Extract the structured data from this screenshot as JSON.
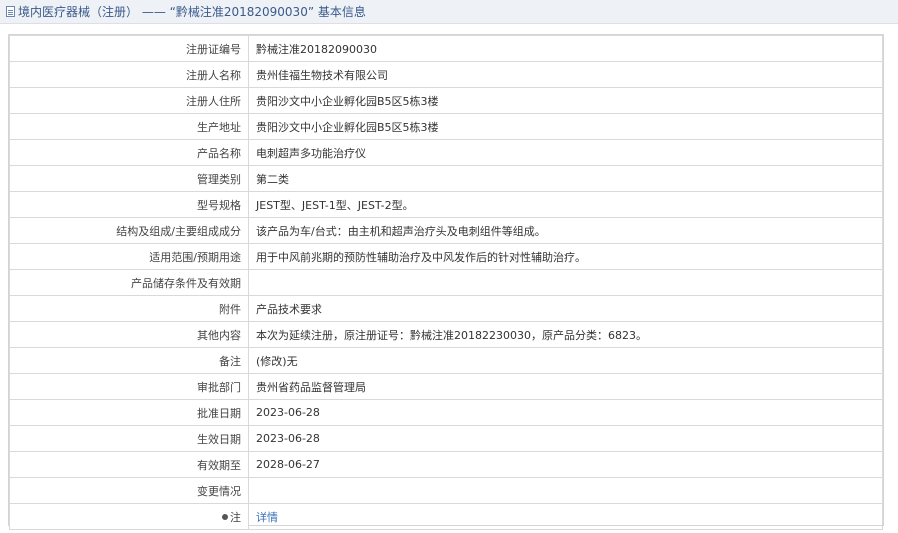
{
  "header": {
    "title": "境内医疗器械（注册） —— “黔械注准20182090030” 基本信息",
    "icon": "document-icon"
  },
  "rows": [
    {
      "label": "注册证编号",
      "value": "黔械注准20182090030"
    },
    {
      "label": "注册人名称",
      "value": "贵州佳福生物技术有限公司"
    },
    {
      "label": "注册人住所",
      "value": "贵阳沙文中小企业孵化园B5区5栋3楼"
    },
    {
      "label": "生产地址",
      "value": "贵阳沙文中小企业孵化园B5区5栋3楼"
    },
    {
      "label": "产品名称",
      "value": "电刺超声多功能治疗仪"
    },
    {
      "label": "管理类别",
      "value": "第二类"
    },
    {
      "label": "型号规格",
      "value": "JEST型、JEST-1型、JEST-2型。"
    },
    {
      "label": "结构及组成/主要组成成分",
      "value": "该产品为车/台式：由主机和超声治疗头及电刺组件等组成。"
    },
    {
      "label": "适用范围/预期用途",
      "value": "用于中风前兆期的预防性辅助治疗及中风发作后的针对性辅助治疗。"
    },
    {
      "label": "产品储存条件及有效期",
      "value": ""
    },
    {
      "label": "附件",
      "value": "产品技术要求"
    },
    {
      "label": "其他内容",
      "value": "本次为延续注册，原注册证号：黔械注准20182230030，原产品分类：6823。"
    },
    {
      "label": "备注",
      "value": "(修改)无"
    },
    {
      "label": "审批部门",
      "value": "贵州省药品监督管理局"
    },
    {
      "label": "批准日期",
      "value": "2023-06-28"
    },
    {
      "label": "生效日期",
      "value": "2023-06-28"
    },
    {
      "label": "有效期至",
      "value": "2028-06-27"
    },
    {
      "label": "变更情况",
      "value": ""
    }
  ],
  "note_row": {
    "icon": "pin-icon",
    "label": "注",
    "link_text": "详情"
  },
  "colors": {
    "title_text": "#3a5a8c",
    "link": "#3d6fb6",
    "border": "#d9d9d9"
  }
}
